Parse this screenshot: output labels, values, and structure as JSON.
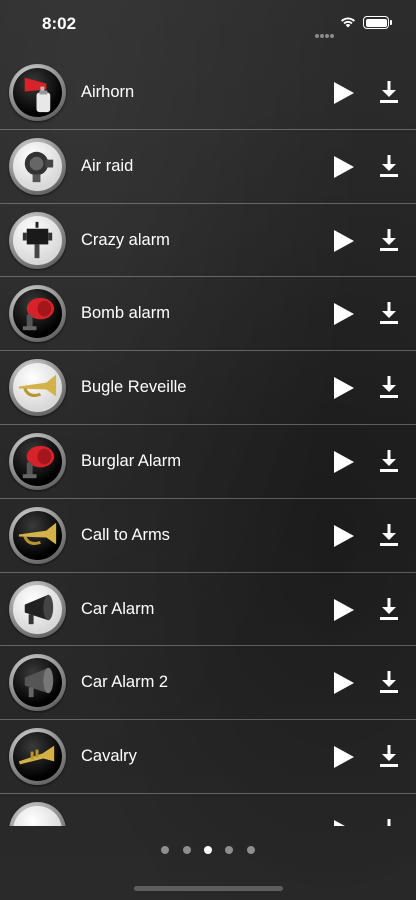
{
  "status_bar": {
    "time": "8:02"
  },
  "sounds": [
    {
      "label": "Airhorn",
      "icon": "airhorn-icon"
    },
    {
      "label": "Air raid",
      "icon": "air-raid-siren-icon"
    },
    {
      "label": "Crazy alarm",
      "icon": "crazy-alarm-siren-icon"
    },
    {
      "label": "Bomb alarm",
      "icon": "bomb-alarm-siren-icon"
    },
    {
      "label": "Bugle Reveille",
      "icon": "bugle-icon"
    },
    {
      "label": "Burglar Alarm",
      "icon": "burglar-alarm-siren-icon"
    },
    {
      "label": "Call to Arms",
      "icon": "bugle-icon"
    },
    {
      "label": "Car Alarm",
      "icon": "car-alarm-speaker-icon"
    },
    {
      "label": "Car Alarm 2",
      "icon": "car-alarm-speaker-icon"
    },
    {
      "label": "Cavalry",
      "icon": "trumpet-icon"
    }
  ],
  "pagination": {
    "pages": 5,
    "current": 3
  },
  "colors": {
    "background": "#262626",
    "siren_red": "#d8222a",
    "brass": "#d4b24a"
  }
}
